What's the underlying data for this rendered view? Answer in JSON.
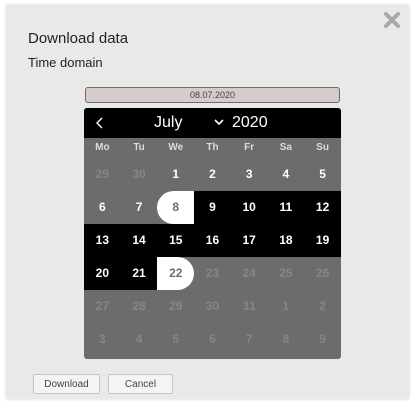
{
  "dialog": {
    "title": "Download data",
    "section_label": "Time domain",
    "close_icon": "close-x-icon"
  },
  "date_field": {
    "value": "08.07.2020"
  },
  "calendar": {
    "month": "July",
    "year": "2020",
    "prev_icon": "chevron-left-icon",
    "month_dropdown_icon": "chevron-down-icon",
    "weekdays": [
      "Mo",
      "Tu",
      "We",
      "Th",
      "Fr",
      "Sa",
      "Su"
    ],
    "weeks": [
      [
        {
          "label": "29",
          "muted": true
        },
        {
          "label": "30",
          "muted": true
        },
        {
          "label": "1"
        },
        {
          "label": "2"
        },
        {
          "label": "3"
        },
        {
          "label": "4"
        },
        {
          "label": "5"
        }
      ],
      [
        {
          "label": "6"
        },
        {
          "label": "7"
        },
        {
          "label": "8",
          "range_start": true
        },
        {
          "label": "9",
          "in_range": true
        },
        {
          "label": "10",
          "in_range": true
        },
        {
          "label": "11",
          "in_range": true
        },
        {
          "label": "12",
          "in_range": true
        }
      ],
      [
        {
          "label": "13",
          "in_range": true
        },
        {
          "label": "14",
          "in_range": true
        },
        {
          "label": "15",
          "in_range": true
        },
        {
          "label": "16",
          "in_range": true
        },
        {
          "label": "17",
          "in_range": true
        },
        {
          "label": "18",
          "in_range": true
        },
        {
          "label": "19",
          "in_range": true
        }
      ],
      [
        {
          "label": "20",
          "in_range": true
        },
        {
          "label": "21",
          "in_range": true
        },
        {
          "label": "22",
          "range_end": true
        },
        {
          "label": "23",
          "disabled": true
        },
        {
          "label": "24",
          "disabled": true
        },
        {
          "label": "25",
          "disabled": true
        },
        {
          "label": "26",
          "disabled": true
        }
      ],
      [
        {
          "label": "27",
          "disabled": true
        },
        {
          "label": "28",
          "disabled": true
        },
        {
          "label": "29",
          "disabled": true
        },
        {
          "label": "30",
          "disabled": true
        },
        {
          "label": "31",
          "disabled": true
        },
        {
          "label": "1",
          "muted": true
        },
        {
          "label": "2",
          "muted": true
        }
      ],
      [
        {
          "label": "3",
          "muted": true
        },
        {
          "label": "4",
          "muted": true
        },
        {
          "label": "5",
          "muted": true
        },
        {
          "label": "6",
          "muted": true
        },
        {
          "label": "7",
          "muted": true
        },
        {
          "label": "8",
          "muted": true
        },
        {
          "label": "9",
          "muted": true
        }
      ]
    ]
  },
  "buttons": {
    "download": "Download",
    "cancel": "Cancel"
  },
  "colors": {
    "dialog_bg": "#e9e9e7",
    "calendar_bg": "#6c6c6c",
    "range_bg": "#000000",
    "endpoint_bg": "#ffffff"
  }
}
